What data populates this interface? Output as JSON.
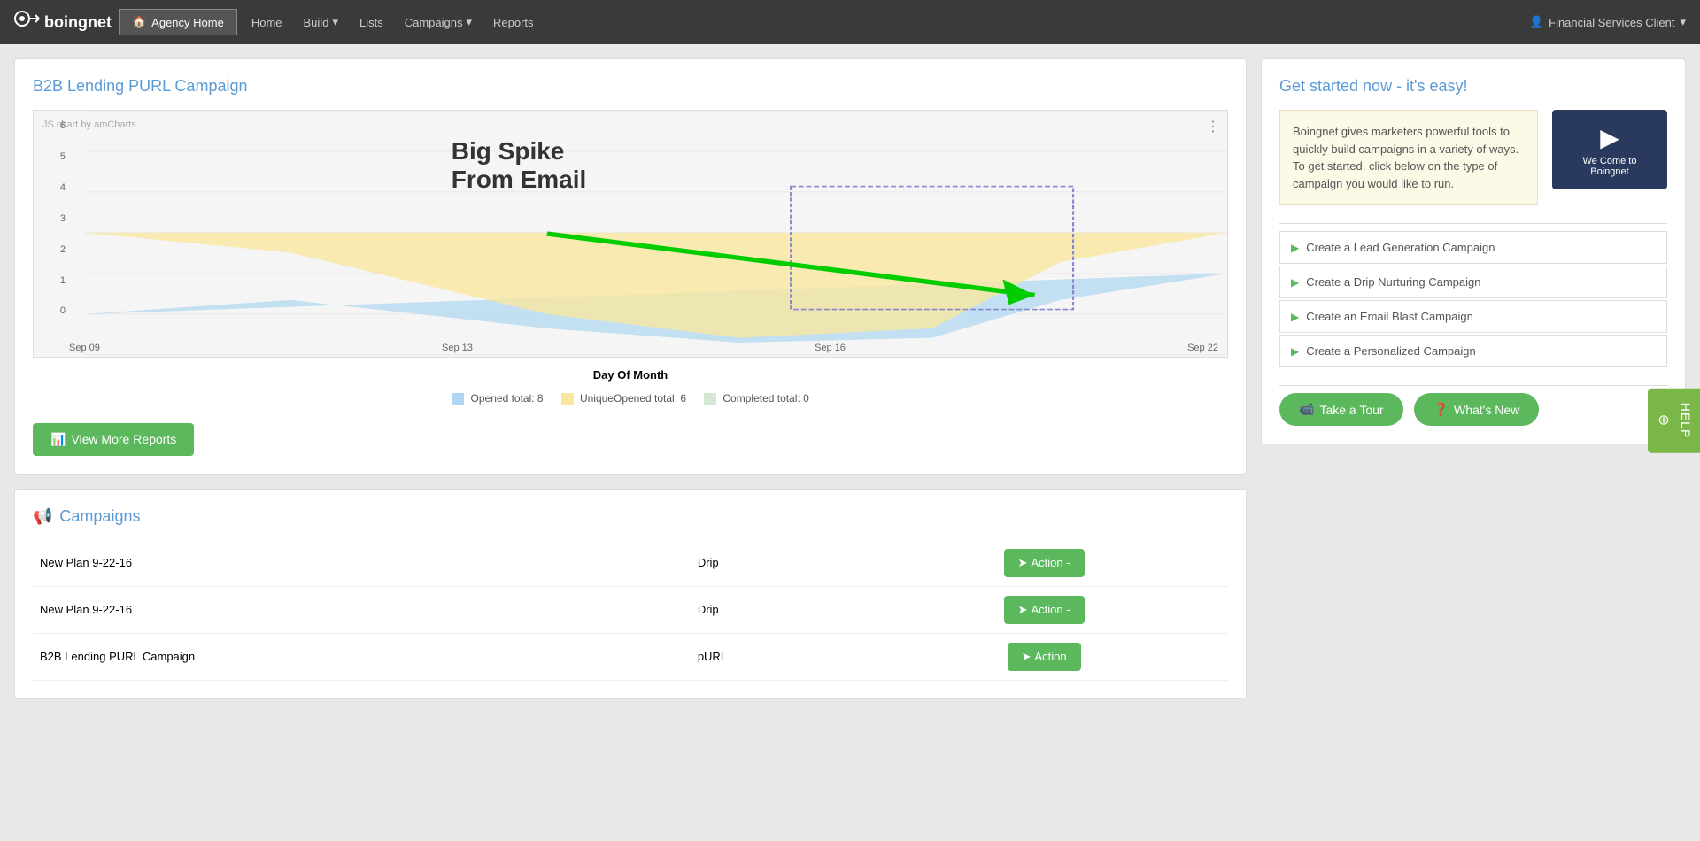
{
  "navbar": {
    "brand": "boingnet",
    "agency_home": "Agency Home",
    "home": "Home",
    "build": "Build",
    "lists": "Lists",
    "campaigns": "Campaigns",
    "reports": "Reports",
    "user": "Financial Services Client"
  },
  "chart_card": {
    "title": "B2B Lending PURL Campaign",
    "watermark": "JS chart by amCharts",
    "annotation": "Big Spike\nFrom Email",
    "x_labels": [
      "Sep 09",
      "Sep 13",
      "Sep 16",
      "Sep 22"
    ],
    "y_labels": [
      "0",
      "1",
      "2",
      "3",
      "4",
      "5",
      "6"
    ],
    "day_label": "Day Of Month",
    "legend": [
      {
        "color": "#aed6f1",
        "label": "Opened total: 8"
      },
      {
        "color": "#f9e79f",
        "label": "UniqueOpened total: 6"
      },
      {
        "color": "#d5e8d4",
        "label": "Completed total: 0"
      }
    ],
    "view_more": "View More Reports"
  },
  "campaigns": {
    "title": "Campaigns",
    "rows": [
      {
        "name": "New Plan 9-22-16",
        "type": "Drip",
        "action": "Action"
      },
      {
        "name": "New Plan 9-22-16",
        "type": "Drip",
        "action": "Action"
      },
      {
        "name": "B2B Lending PURL Campaign",
        "type": "pURL",
        "action": "Action"
      }
    ]
  },
  "get_started": {
    "title": "Get started now - it's easy!",
    "intro_text": "Boingnet gives marketers powerful tools to quickly build campaigns in a variety of ways. To get started, click below on the type of campaign you would like to run.",
    "video_line1": "We Come to",
    "video_line2": "Boingnet",
    "campaign_links": [
      "Create a Lead Generation Campaign",
      "Create a Drip Nurturing Campaign",
      "Create an Email Blast Campaign",
      "Create a Personalized Campaign"
    ],
    "take_tour": "Take a Tour",
    "whats_new": "What's New"
  },
  "help_tab": "HELP"
}
